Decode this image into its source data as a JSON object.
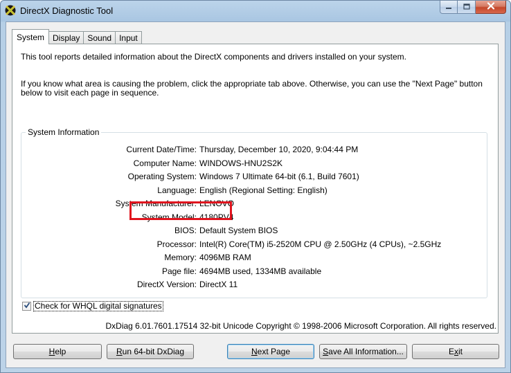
{
  "window": {
    "title": "DirectX Diagnostic Tool"
  },
  "tabs": [
    {
      "label": "System",
      "active": true
    },
    {
      "label": "Display",
      "active": false
    },
    {
      "label": "Sound",
      "active": false
    },
    {
      "label": "Input",
      "active": false
    }
  ],
  "intro": {
    "line1": "This tool reports detailed information about the DirectX components and drivers installed on your system.",
    "line2": "If you know what area is causing the problem, click the appropriate tab above.  Otherwise, you can use the \"Next Page\" button below to visit each page in sequence."
  },
  "system_info": {
    "group_title": "System Information",
    "rows": [
      {
        "label": "Current Date/Time:",
        "value": "Thursday, December 10, 2020, 9:04:44 PM"
      },
      {
        "label": "Computer Name:",
        "value": "WINDOWS-HNU2S2K"
      },
      {
        "label": "Operating System:",
        "value": "Windows 7 Ultimate 64-bit (6.1, Build 7601)"
      },
      {
        "label": "Language:",
        "value": "English (Regional Setting: English)"
      },
      {
        "label": "System Manufacturer:",
        "value": "LENOVO"
      },
      {
        "label": "System Model:",
        "value": "4180PV4"
      },
      {
        "label": "BIOS:",
        "value": "Default System BIOS"
      },
      {
        "label": "Processor:",
        "value": "Intel(R) Core(TM) i5-2520M CPU @ 2.50GHz (4 CPUs), ~2.5GHz"
      },
      {
        "label": "Memory:",
        "value": "4096MB RAM"
      },
      {
        "label": "Page file:",
        "value": "4694MB used, 1334MB available"
      },
      {
        "label": "DirectX Version:",
        "value": "DirectX 11"
      }
    ]
  },
  "whql": {
    "label": "Check for WHQL digital signatures",
    "checked": true
  },
  "footer": {
    "copyright": "DxDiag 6.01.7601.17514 32-bit Unicode  Copyright © 1998-2006 Microsoft Corporation.  All rights reserved."
  },
  "buttons": {
    "help": {
      "mnemonic": "H",
      "rest": "elp"
    },
    "run64": {
      "mnemonic": "R",
      "rest": "un 64-bit DxDiag"
    },
    "next": {
      "mnemonic": "N",
      "rest": "ext Page"
    },
    "save": {
      "mnemonic": "S",
      "rest": "ave All Information..."
    },
    "exit": {
      "pre": "E",
      "mnemonic": "x",
      "rest": "it"
    }
  },
  "colors": {
    "highlight": "#e0141e",
    "title_bar": "#bcd4ea"
  },
  "icons": {
    "app": "directx-icon",
    "minimize": "minimize-icon",
    "maximize": "maximize-icon",
    "close": "close-icon",
    "check": "checkmark-icon"
  }
}
